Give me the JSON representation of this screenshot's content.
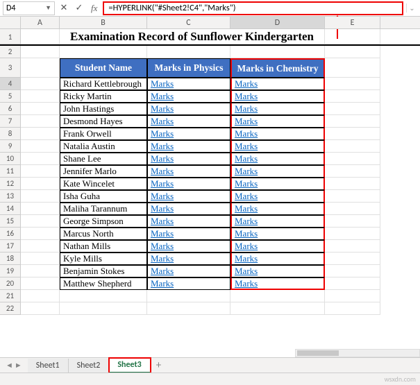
{
  "cellRef": "D4",
  "formula": "=HYPERLINK(\"#Sheet2!C4\",\"Marks\")",
  "title": "Examination Record of Sunflower Kindergarten",
  "columns": [
    "A",
    "B",
    "C",
    "D",
    "E"
  ],
  "headers": {
    "b": "Student Name",
    "c": "Marks in Physics",
    "d": "Marks in Chemistry"
  },
  "link_text": "Marks",
  "students": [
    "Richard Kettlebrough",
    "Ricky Martin",
    "John Hastings",
    "Desmond Hayes",
    "Frank Orwell",
    "Natalia Austin",
    "Shane Lee",
    "Jennifer Marlo",
    "Kate Wincelet",
    "Isha Guha",
    "Maliha Tarannum",
    "George Simpson",
    "Marcus North",
    "Nathan Mills",
    "Kyle Mills",
    "Benjamin Stokes",
    "Matthew Shepherd"
  ],
  "tabs": [
    "Sheet1",
    "Sheet2",
    "Sheet3"
  ],
  "active_tab": "Sheet3",
  "tab_add": "+",
  "watermark": "wsxdn.com",
  "chart_data": {
    "type": "table",
    "title": "Examination Record of Sunflower Kindergarten",
    "columns": [
      "Student Name",
      "Marks in Physics",
      "Marks in Chemistry"
    ],
    "rows": [
      [
        "Richard Kettlebrough",
        "Marks",
        "Marks"
      ],
      [
        "Ricky Martin",
        "Marks",
        "Marks"
      ],
      [
        "John Hastings",
        "Marks",
        "Marks"
      ],
      [
        "Desmond Hayes",
        "Marks",
        "Marks"
      ],
      [
        "Frank Orwell",
        "Marks",
        "Marks"
      ],
      [
        "Natalia Austin",
        "Marks",
        "Marks"
      ],
      [
        "Shane Lee",
        "Marks",
        "Marks"
      ],
      [
        "Jennifer Marlo",
        "Marks",
        "Marks"
      ],
      [
        "Kate Wincelet",
        "Marks",
        "Marks"
      ],
      [
        "Isha Guha",
        "Marks",
        "Marks"
      ],
      [
        "Maliha Tarannum",
        "Marks",
        "Marks"
      ],
      [
        "George Simpson",
        "Marks",
        "Marks"
      ],
      [
        "Marcus North",
        "Marks",
        "Marks"
      ],
      [
        "Nathan Mills",
        "Marks",
        "Marks"
      ],
      [
        "Kyle Mills",
        "Marks",
        "Marks"
      ],
      [
        "Benjamin Stokes",
        "Marks",
        "Marks"
      ],
      [
        "Matthew Shepherd",
        "Marks",
        "Marks"
      ]
    ]
  }
}
